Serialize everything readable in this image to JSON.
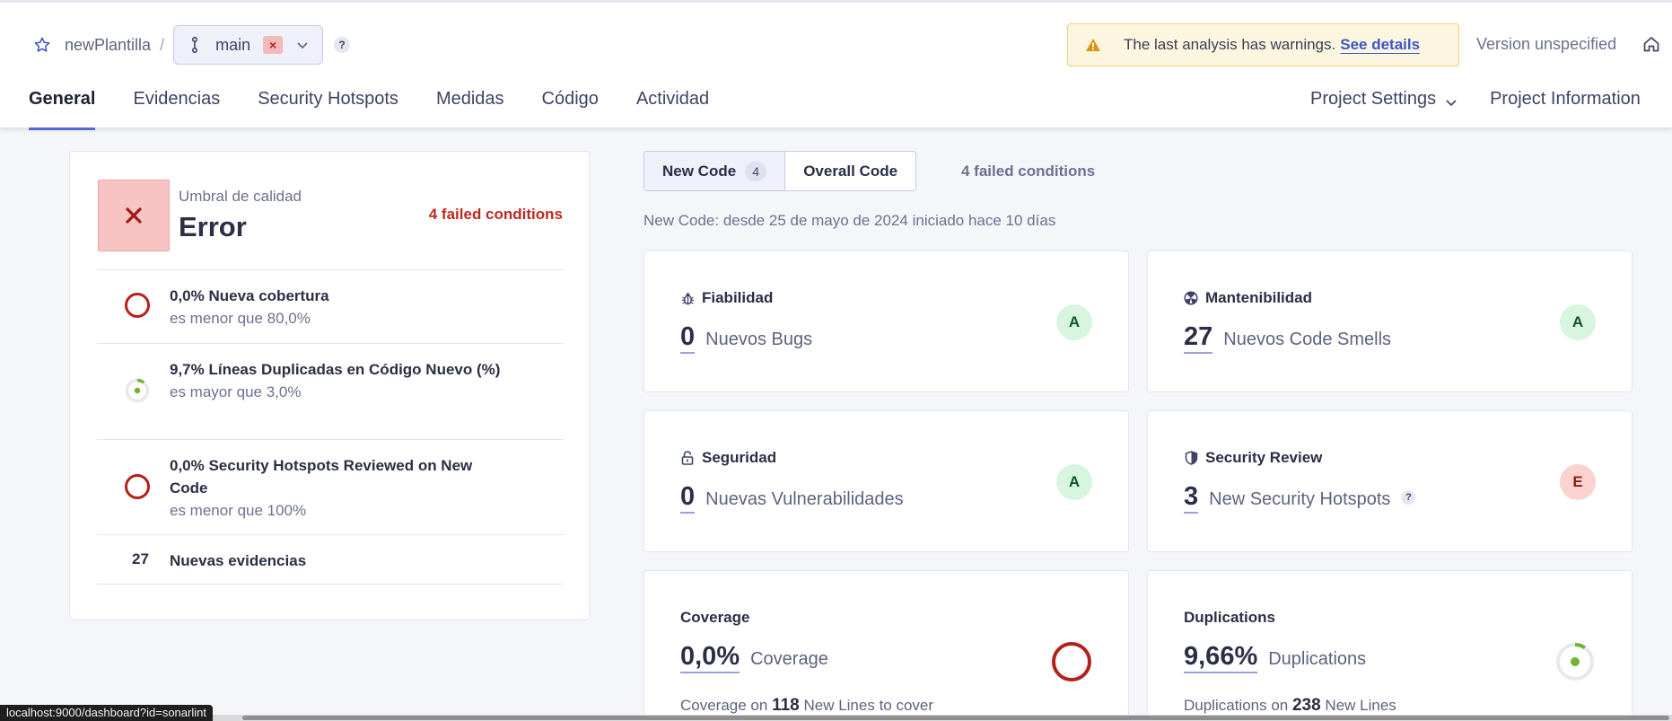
{
  "header": {
    "project_name": "newPlantilla",
    "separator": "/",
    "branch": {
      "name": "main",
      "status_symbol": "×"
    },
    "help": "?",
    "warning": {
      "text": "The last analysis has warnings.",
      "link": "See details"
    },
    "version": "Version unspecified"
  },
  "nav": {
    "tabs": [
      {
        "label": "General",
        "active": true
      },
      {
        "label": "Evidencias"
      },
      {
        "label": "Security Hotspots"
      },
      {
        "label": "Medidas"
      },
      {
        "label": "Código"
      },
      {
        "label": "Actividad"
      }
    ],
    "project_settings": "Project Settings",
    "project_information": "Project Information"
  },
  "quality_gate": {
    "label": "Umbral de calidad",
    "status": "Error",
    "failed_conditions": "4 failed conditions",
    "conditions": [
      {
        "title": "0,0% Nueva cobertura",
        "sub": "es menor que 80,0%"
      },
      {
        "title": "9,7% Líneas Duplicadas en Código Nuevo (%)",
        "sub": "es mayor que 3,0%"
      },
      {
        "title": "0,0% Security Hotspots Reviewed on New Code",
        "sub": "es menor que 100%"
      }
    ],
    "issues": {
      "count": "27",
      "label": "Nuevas evidencias"
    }
  },
  "code_toggle": {
    "new_code": "New Code",
    "new_code_count": "4",
    "overall_code": "Overall Code",
    "failed_conditions": "4 failed conditions"
  },
  "since": "New Code: desde 25 de mayo de 2024  iniciado hace 10 días",
  "cards": {
    "reliability": {
      "title": "Fiabilidad",
      "value": "0",
      "label": "Nuevos Bugs",
      "rating": "A"
    },
    "maintainability": {
      "title": "Mantenibilidad",
      "value": "27",
      "label": "Nuevos Code Smells",
      "rating": "A"
    },
    "security": {
      "title": "Seguridad",
      "value": "0",
      "label": "Nuevas Vulnerabilidades",
      "rating": "A"
    },
    "security_review": {
      "title": "Security Review",
      "value": "3",
      "label": "New Security Hotspots",
      "help": "?",
      "rating": "E"
    },
    "coverage": {
      "title": "Coverage",
      "value": "0,0%",
      "label": "Coverage",
      "sub_prefix": "Coverage on",
      "sub_num": "118",
      "sub_suffix": "New Lines to cover"
    },
    "duplications": {
      "title": "Duplications",
      "value": "9,66%",
      "label": "Duplications",
      "sub_prefix": "Duplications on",
      "sub_num": "238",
      "sub_suffix": "New Lines",
      "fraction": 0.0966
    }
  },
  "status_bar_url": "localhost:9000/dashboard?id=sonarlint",
  "colors": {
    "accent": "#5469d4",
    "error": "#c0281f",
    "good": "#d7f5df",
    "bad": "#fad3d0"
  }
}
